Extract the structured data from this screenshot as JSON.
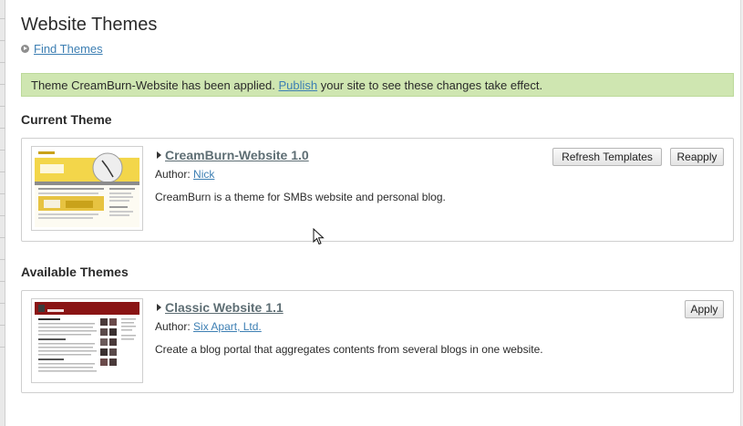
{
  "page": {
    "title": "Website Themes",
    "find_themes": "Find Themes"
  },
  "message": {
    "prefix": "Theme CreamBurn-Website has been applied.",
    "publish_link": "Publish",
    "suffix": "your site to see these changes take effect."
  },
  "current": {
    "section_title": "Current Theme",
    "theme": {
      "name": "CreamBurn-Website 1.0",
      "author_label": "Author:",
      "author": "Nick",
      "description": "CreamBurn is a theme for SMBs website and personal blog.",
      "buttons": {
        "refresh": "Refresh Templates",
        "reapply": "Reapply"
      }
    }
  },
  "available": {
    "section_title": "Available Themes",
    "theme": {
      "name": "Classic Website 1.1",
      "author_label": "Author:",
      "author": "Six Apart, Ltd.",
      "description": "Create a blog portal that aggregates contents from several blogs in one website.",
      "buttons": {
        "apply": "Apply"
      }
    }
  },
  "colors": {
    "message_bg": "#cfe6b1",
    "link": "#3d7fb3",
    "theme_name": "#5e6e74"
  },
  "icons": {
    "find": "play-circle-icon",
    "expand": "triangle-right-icon",
    "cursor": "mouse-pointer-icon"
  }
}
